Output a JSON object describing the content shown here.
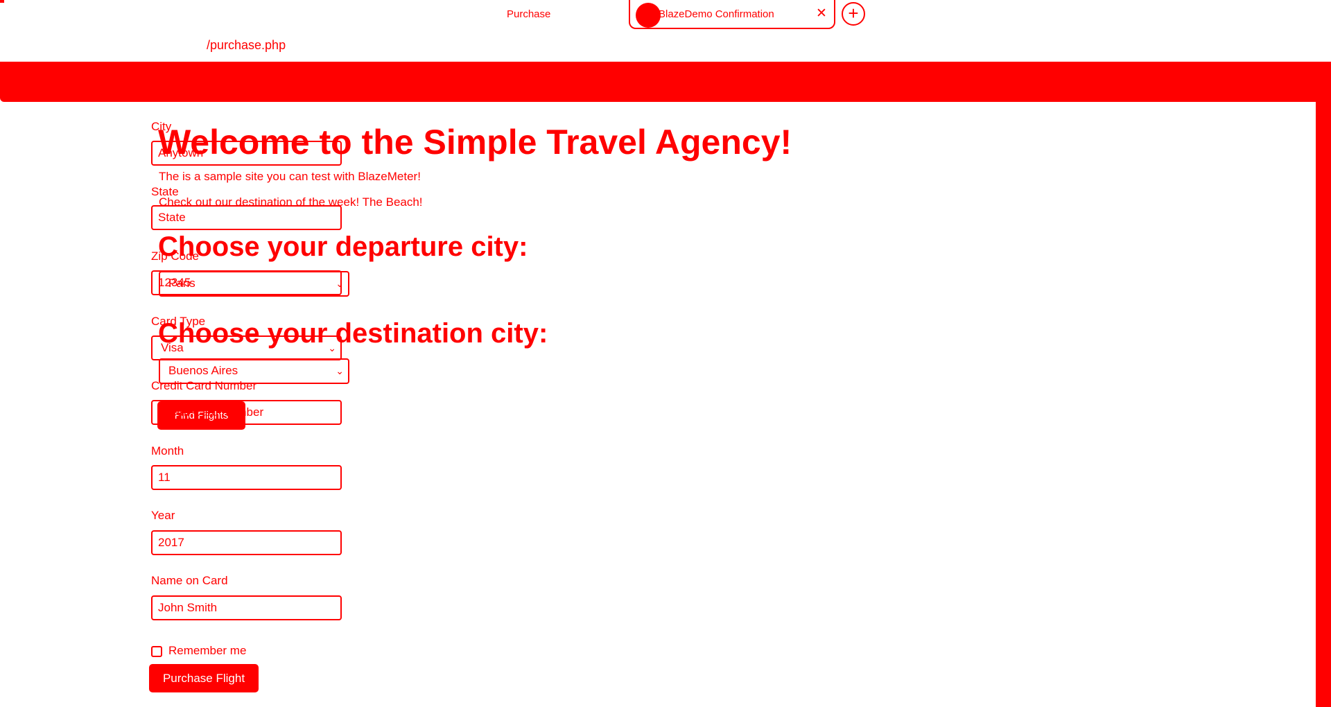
{
  "browser": {
    "tabs": [
      {
        "label": "Purchase"
      },
      {
        "label": "BlazeDemo Confirmation"
      }
    ],
    "close_glyph": "✕",
    "new_tab_glyph": "+",
    "url": "/purchase.php"
  },
  "welcome": {
    "title": "Welcome to the Simple Travel Agency!",
    "line1": "The is a sample site you can test with BlazeMeter!",
    "line2": "Check out our destination of the week! The Beach!",
    "departure_heading": "Choose your departure city:",
    "departure_value": "Paris",
    "destination_heading": "Choose your destination city:",
    "destination_value": "Buenos Aires",
    "find_button": "Find Flights"
  },
  "form": {
    "city": {
      "label": "City",
      "value": "Anytown"
    },
    "state": {
      "label": "State",
      "value": "State"
    },
    "zip": {
      "label": "Zip Code",
      "value": "12345"
    },
    "card_type": {
      "label": "Card Type",
      "value": "Visa"
    },
    "card_number": {
      "label": "Credit Card Number",
      "value": "Credit Card Number"
    },
    "month": {
      "label": "Month",
      "value": "11"
    },
    "year": {
      "label": "Year",
      "value": "2017"
    },
    "name": {
      "label": "Name on Card",
      "value": "John Smith"
    },
    "remember_label": "Remember me",
    "purchase_button": "Purchase Flight"
  },
  "colors": {
    "accent": "#ff0000",
    "background": "#ffffff"
  },
  "icons": {
    "favicon": "circle-favicon-icon",
    "chevron": "chevron-down-icon",
    "close": "close-icon",
    "new_tab": "plus-icon"
  }
}
